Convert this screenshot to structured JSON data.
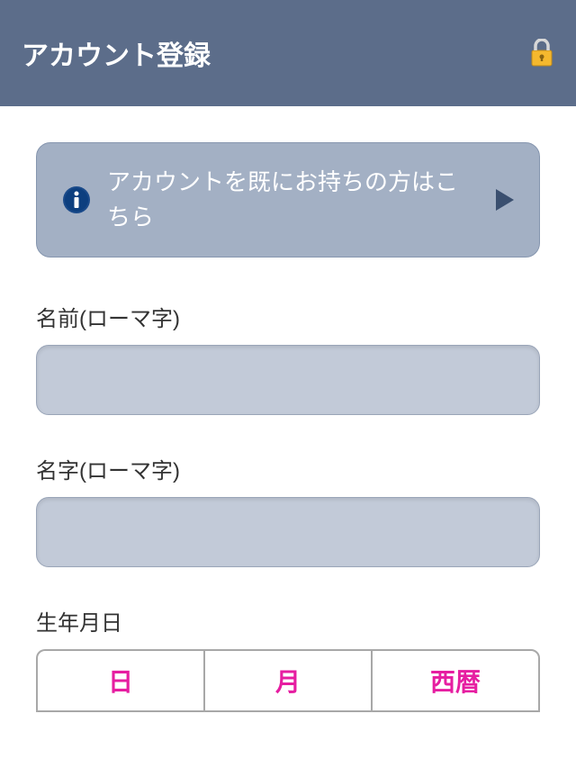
{
  "header": {
    "title": "アカウント登録"
  },
  "info_banner": {
    "text": "アカウントを既にお持ちの方はこちら"
  },
  "fields": {
    "first_name": {
      "label": "名前(ローマ字)",
      "value": ""
    },
    "last_name": {
      "label": "名字(ローマ字)",
      "value": ""
    },
    "dob": {
      "label": "生年月日",
      "day": "日",
      "month": "月",
      "year": "西暦"
    }
  }
}
